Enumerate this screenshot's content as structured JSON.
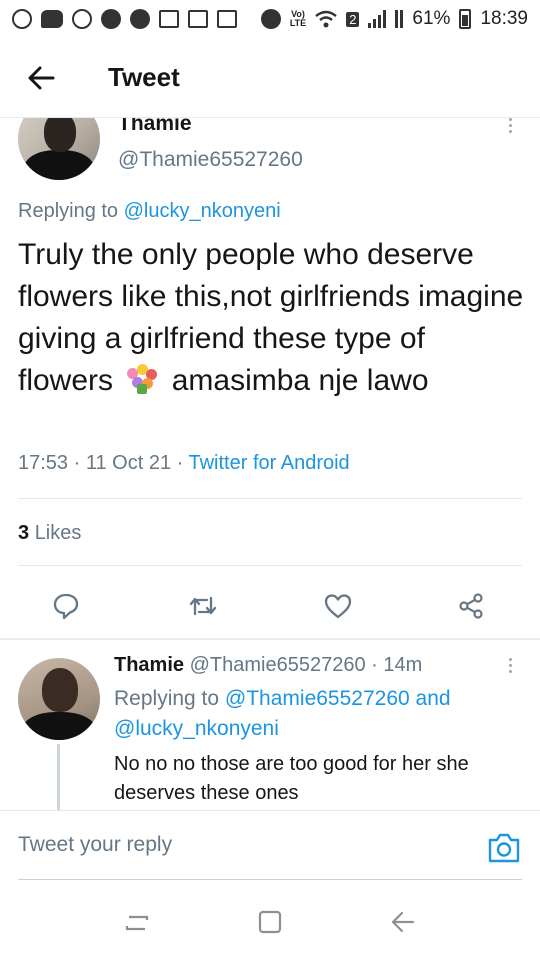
{
  "status_bar": {
    "battery_percent": "61%",
    "time": "18:39",
    "network_label": "LTE",
    "sim_slot": "2"
  },
  "header": {
    "title": "Tweet"
  },
  "main_tweet": {
    "author_name": "Thamie",
    "author_handle": "@Thamie65527260",
    "replying_prefix": "Replying to",
    "replying_to": "@lucky_nkonyeni",
    "text_before_emoji": "Truly the only people who deserve flowers like this,not girlfriends imagine giving a girlfriend these type of flowers",
    "text_after_emoji": "amasimba nje lawo",
    "time": "17:53",
    "date": "11 Oct 21",
    "source": "Twitter for Android",
    "likes_count": "3",
    "likes_label": "Likes"
  },
  "reply_tweet": {
    "author_name": "Thamie",
    "author_handle": "@Thamie65527260",
    "age": "14m",
    "replying_prefix": "Replying to",
    "replying_to_1": "@Thamie65527260",
    "replying_and": "and",
    "replying_to_2": "@lucky_nkonyeni",
    "text": "No no no those are too good for  her she deserves these ones"
  },
  "compose": {
    "placeholder": "Tweet your reply"
  },
  "colors": {
    "link": "#1b95e0",
    "secondary_text": "#657786",
    "primary_text": "#14171a"
  }
}
